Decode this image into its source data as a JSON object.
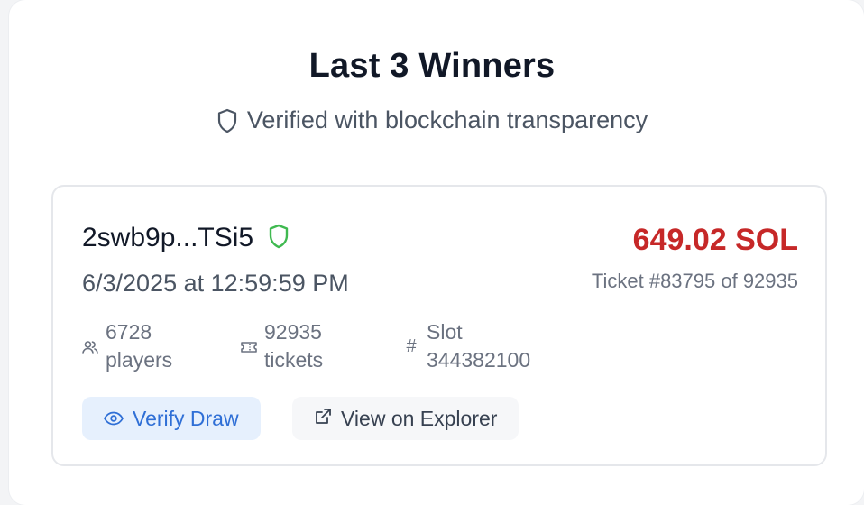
{
  "header": {
    "title": "Last 3 Winners",
    "subtitle": "Verified with blockchain transparency"
  },
  "winner": {
    "address": "2swb9p...TSi5",
    "date": "6/3/2025 at 12:59:59 PM",
    "amount": "649.02 SOL",
    "ticket": "Ticket #83795 of 92935",
    "stats": {
      "players_value": "6728",
      "players_label": "players",
      "tickets_value": "92935",
      "tickets_label": "tickets",
      "slot_label": "Slot",
      "slot_value": "344382100"
    },
    "actions": {
      "verify_label": "Verify Draw",
      "explorer_label": "View on Explorer"
    }
  },
  "colors": {
    "amount": "#c62828",
    "verified_shield": "#3fb950",
    "verify_button_text": "#2f6fd6",
    "verify_button_bg": "#e6f0fd"
  },
  "icons": {
    "subtitle": "shield-icon",
    "verified": "shield-check-icon",
    "players": "users-icon",
    "tickets": "ticket-icon",
    "slot": "hash-icon",
    "verify": "eye-icon",
    "explorer": "external-link-icon"
  }
}
